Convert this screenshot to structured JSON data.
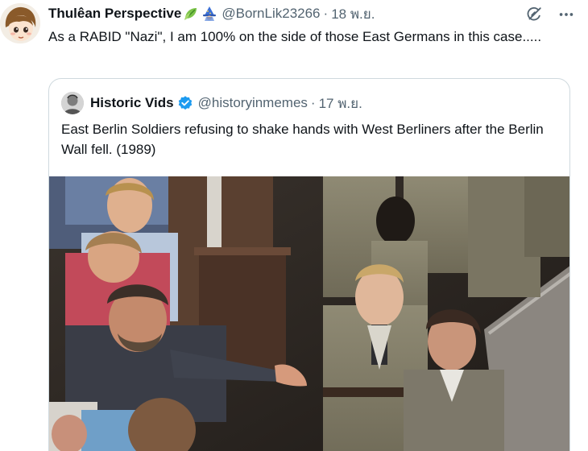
{
  "tweet": {
    "display_name": "Thulêan Perspective",
    "name_emoji": [
      "leaf-emoji",
      "wizard-emoji"
    ],
    "handle": "@BornLik23266",
    "separator": "·",
    "time": "18 พ.ย.",
    "text": "As a RABID \"Nazi\", I am 100% on the side of those East Germans in this case.....",
    "actions": [
      "grok-icon",
      "more-icon"
    ]
  },
  "quote": {
    "display_name": "Historic Vids",
    "verified": true,
    "handle": "@historyinmemes",
    "separator": "·",
    "time": "17 พ.ย.",
    "text": "East Berlin Soldiers refusing to shake hands with West Berliners after the Berlin Wall fell. (1989)",
    "media": "photo-soldiers-and-civilians"
  },
  "colors": {
    "text": "#0f1419",
    "secondary": "#536471",
    "border": "#cfd9de",
    "verified": "#1d9bf0"
  }
}
